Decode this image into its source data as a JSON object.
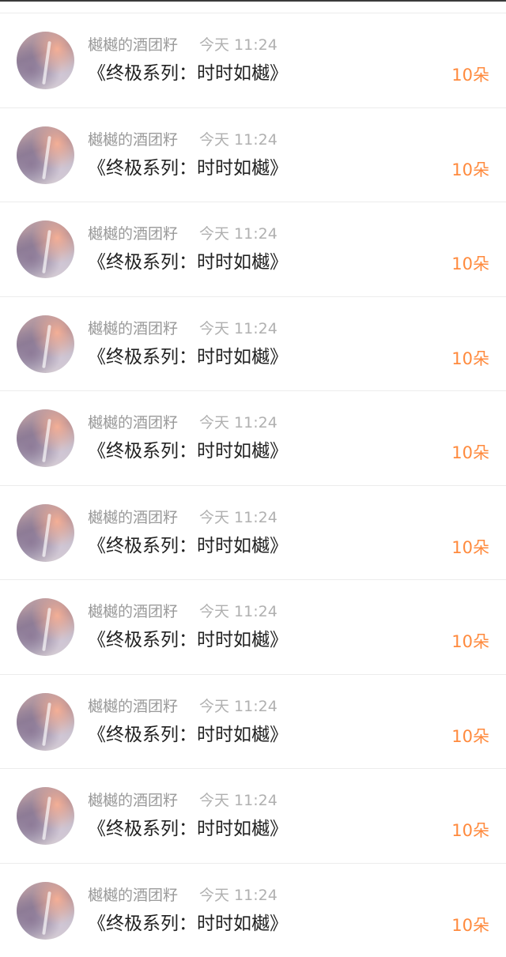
{
  "items": [
    {
      "name": "樾樾的酒团籽",
      "time": "今天 11:24",
      "title": "《终极系列：时时如樾》",
      "count": "10朵"
    },
    {
      "name": "樾樾的酒团籽",
      "time": "今天 11:24",
      "title": "《终极系列：时时如樾》",
      "count": "10朵"
    },
    {
      "name": "樾樾的酒团籽",
      "time": "今天 11:24",
      "title": "《终极系列：时时如樾》",
      "count": "10朵"
    },
    {
      "name": "樾樾的酒团籽",
      "time": "今天 11:24",
      "title": "《终极系列：时时如樾》",
      "count": "10朵"
    },
    {
      "name": "樾樾的酒团籽",
      "time": "今天 11:24",
      "title": "《终极系列：时时如樾》",
      "count": "10朵"
    },
    {
      "name": "樾樾的酒团籽",
      "time": "今天 11:24",
      "title": "《终极系列：时时如樾》",
      "count": "10朵"
    },
    {
      "name": "樾樾的酒团籽",
      "time": "今天 11:24",
      "title": "《终极系列：时时如樾》",
      "count": "10朵"
    },
    {
      "name": "樾樾的酒团籽",
      "time": "今天 11:24",
      "title": "《终极系列：时时如樾》",
      "count": "10朵"
    },
    {
      "name": "樾樾的酒团籽",
      "time": "今天 11:24",
      "title": "《终极系列：时时如樾》",
      "count": "10朵"
    },
    {
      "name": "樾樾的酒团籽",
      "time": "今天 11:24",
      "title": "《终极系列：时时如樾》",
      "count": "10朵"
    }
  ],
  "colors": {
    "accent": "#ff8a3d",
    "name": "#9a9a9a",
    "time": "#b0b0b0",
    "title": "#222222"
  }
}
